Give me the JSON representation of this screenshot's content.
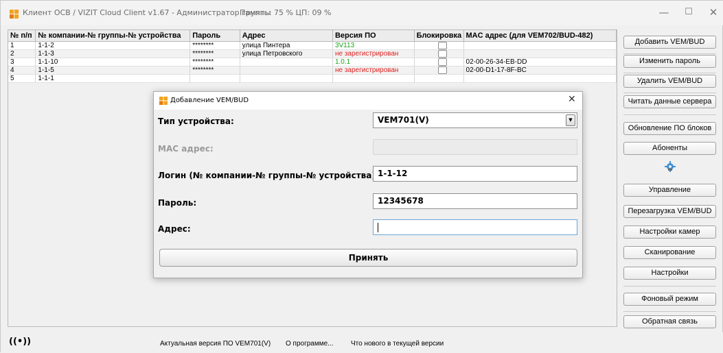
{
  "window": {
    "title": "Клиент ОСВ / VIZIT Cloud Client v1.67 - Администратор группы",
    "stats": "Память: 75 %  ЦП: 09 %",
    "minimize": "—",
    "maximize": "☐",
    "close": "✕"
  },
  "table": {
    "columns": [
      "№ п/п",
      "№ компании-№ группы-№ устройства",
      "Пароль",
      "Адрес",
      "Версия ПО",
      "Блокировка",
      "MAC адрес (для VEM702/BUD-482)"
    ],
    "rows": [
      {
        "num": "1",
        "login": "1-1-2",
        "password": "********",
        "address": "улица Пинтера",
        "version": "3V113",
        "mac": ""
      },
      {
        "num": "2",
        "login": "1-1-3",
        "password": "********",
        "address": "улица Петровского",
        "version": "не зарегистрирован",
        "mac": ""
      },
      {
        "num": "3",
        "login": "1-1-10",
        "password": "********",
        "address": "",
        "version": "1.0.1",
        "mac": "02-00-26-34-EB-DD"
      },
      {
        "num": "4",
        "login": "1-1-5",
        "password": "********",
        "address": "",
        "version": "не зарегистрирован",
        "mac": "02-00-D1-17-8F-BC"
      },
      {
        "num": "5",
        "login": "1-1-1",
        "password": "",
        "address": "",
        "version": "",
        "mac": ""
      }
    ]
  },
  "sidebar": {
    "add": "Добавить VEM/BUD",
    "change_password": "Изменить пароль",
    "delete": "Удалить VEM/BUD",
    "read_server": "Читать данные сервера",
    "update_fw": "Обновление ПО блоков",
    "subscribers": "Абоненты",
    "control": "Управление",
    "reboot": "Перезагрузка VEM/BUD",
    "camera_settings": "Настройки камер",
    "scan": "Сканирование",
    "settings": "Настройки",
    "background": "Фоновый режим",
    "feedback": "Обратная связь"
  },
  "statusbar": {
    "connection_icon": "((•))",
    "actual_version": "Актуальная версия ПО VEM701(V)",
    "about": "О программе...",
    "whats_new": "Что нового в текущей версии"
  },
  "dialog": {
    "title": "Добавление VEM/BUD",
    "close": "✕",
    "device_type_label": "Тип устройства:",
    "device_type_value": "VEM701(V)",
    "mac_label": "MAC адрес:",
    "mac_value": "",
    "login_label": "Логин (№ компании-№ группы-№ устройства):",
    "login_value": "1-1-12",
    "password_label": "Пароль:",
    "password_value": "12345678",
    "address_label": "Адрес:",
    "address_value": "",
    "accept": "Принять"
  },
  "colors": {
    "version_ok": "#19a319",
    "version_unregistered": "#e11e1e",
    "focus_border": "#6ea2d6"
  }
}
